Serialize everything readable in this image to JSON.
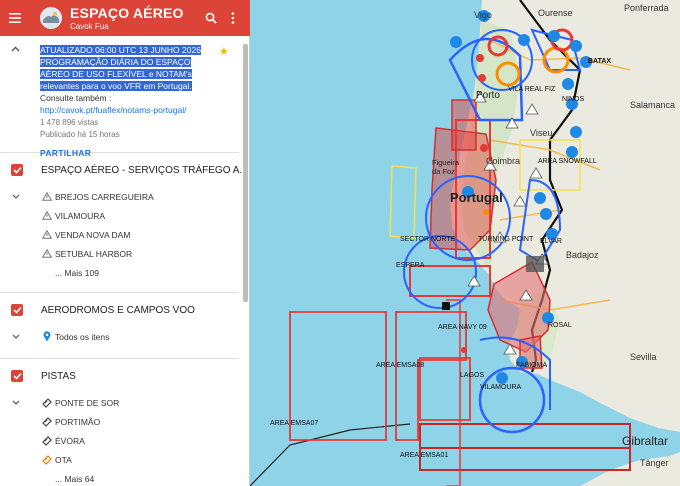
{
  "header": {
    "title": "ESPAÇO AÉREO",
    "subtitle": "Cavok Fua"
  },
  "info": {
    "highlighted_text": "ATUALIZADO 06:00 UTC 13 JUNHO 2026 PROGRAMAÇÃO DIÁRIA DO ESPAÇO AÉREO DE USO FLEXÍVEL e NOTAM's relevantes para o voo VFR em Portugal.",
    "consult_text": " Consulte também :",
    "link": "http://cavok.pt/fuaflex/notams-portugal/",
    "views": "1 478 896 vistas",
    "published": "Publicado há 15 horas",
    "share_label": "PARTILHAR"
  },
  "layers": [
    {
      "title": "ESPAÇO AÉREO - SERVIÇOS TRÁFEGO A...",
      "items": [
        "BREJOS CARREGUEIRA",
        "VILAMOURA",
        "VENDA NOVA DAM",
        "SETUBAL HARBOR"
      ],
      "more": "... Mais 109"
    },
    {
      "title": "AERODROMOS E CAMPOS VOO",
      "items": [
        "Todos os itens"
      ]
    },
    {
      "title": "PISTAS",
      "items": [
        "PONTE DE SOR",
        "PORTIMÃO",
        "ÉVORA",
        "OTA"
      ],
      "more": "... Mais 64"
    }
  ],
  "map": {
    "labels": {
      "vigo": "Vigo",
      "ourense": "Ourense",
      "ponferrada": "Ponferrada",
      "viseu": "Viseu",
      "bataix": "BATAX",
      "salamanca": "Salamanca",
      "porto": "Porto",
      "vila_real": "VILA REAL FIZ",
      "ninos": "NINOS",
      "coimbra": "Coimbra",
      "area_snowfall": "AREA SNOWFALL",
      "portugal": "Portugal",
      "figueira": "Figueira da Foz",
      "sector_norte": "SECTOR NORTE",
      "turning_point": "TURNING POINT",
      "elvar": "ELVAR",
      "badajoz": "Badajoz",
      "espera": "ESPERA",
      "area_navy": "AREA NAVY 09",
      "area_emsa08": "AREA EMSA08",
      "fabioma": "FABIOMA",
      "vilamoura": "VILAMOURA",
      "lagos": "LAGOS",
      "area_emsa07": "AREA EMSA07",
      "area_emsa01": "AREA EMSA01",
      "sevilla": "Sevilla",
      "gibraltar": "Gibraltar",
      "tanger": "Tânger",
      "rosal": "ROSAL",
      "ovar": "OVAR",
      "elro": "ELRO"
    }
  },
  "colors": {
    "header_bg": "#db4437",
    "selection": "#3367d6",
    "link": "#1a73e8",
    "sea": "#8fd3e8",
    "land": "#eaeae0",
    "airspace_red": "#e53935",
    "airspace_blue": "#2962ff"
  }
}
